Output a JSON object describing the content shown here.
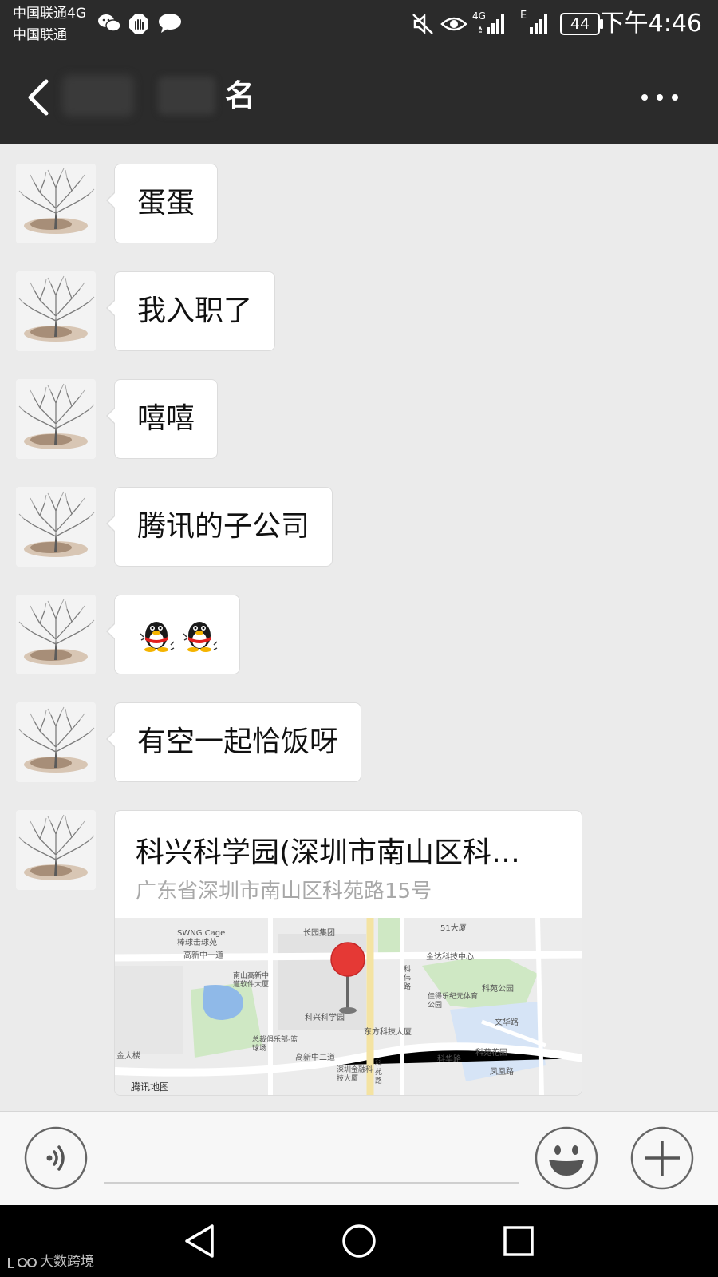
{
  "status_bar": {
    "carrier_primary": "中国联通4G",
    "carrier_secondary": "中国联通",
    "network_sim1": "4G",
    "network_sim2": "E",
    "battery": "44",
    "time": "下午4:46",
    "icons": [
      "wechat-icon",
      "hand-icon",
      "message-icon",
      "mute-icon",
      "eye-icon",
      "signal-icon",
      "signal-icon",
      "battery-icon"
    ]
  },
  "header": {
    "title_visible": "名",
    "back_icon": "chevron-left-icon",
    "more_icon": "more-dots-icon"
  },
  "messages": [
    {
      "type": "text",
      "text": "蛋蛋"
    },
    {
      "type": "text",
      "text": "我入职了"
    },
    {
      "type": "text",
      "text": "嘻嘻"
    },
    {
      "type": "text",
      "text": "腾讯的子公司"
    },
    {
      "type": "sticker",
      "stickers": [
        "penguin-emoji",
        "penguin-emoji"
      ]
    },
    {
      "type": "text",
      "text": "有空一起恰饭呀"
    },
    {
      "type": "location",
      "name": "科兴科学园(深圳市南山区科…",
      "address": "广东省深圳市南山区科苑路15号",
      "map": {
        "provider": "腾讯地图",
        "labels": [
          "SWNG Cage",
          "棒球击球苑",
          "长园集团",
          "51大厦",
          "高新中一道",
          "南山高新中一道软件大厦",
          "金达科技中心",
          "科伟路",
          "科苑公园",
          "佳得乐纪元体育公园",
          "科兴科学园",
          "东方科技大厦",
          "文华路",
          "总裁俱乐部-篮球场",
          "科苑花园",
          "高新中二道",
          "科华路",
          "深圳金融科技大厦",
          "凤凰路",
          "科苑路",
          "金大楼"
        ]
      }
    }
  ],
  "input_bar": {
    "voice_icon": "voice-icon",
    "emoji_icon": "emoji-icon",
    "plus_icon": "plus-icon",
    "input_value": ""
  },
  "nav_bar": {
    "icons": [
      "nav-back-icon",
      "nav-home-icon",
      "nav-recent-icon"
    ],
    "watermark": "大数跨境"
  },
  "colors": {
    "status_bar_bg": "#2b2b2b",
    "chat_bg": "#ebebeb",
    "bubble_bg": "#ffffff",
    "map_pin": "#e53935"
  }
}
